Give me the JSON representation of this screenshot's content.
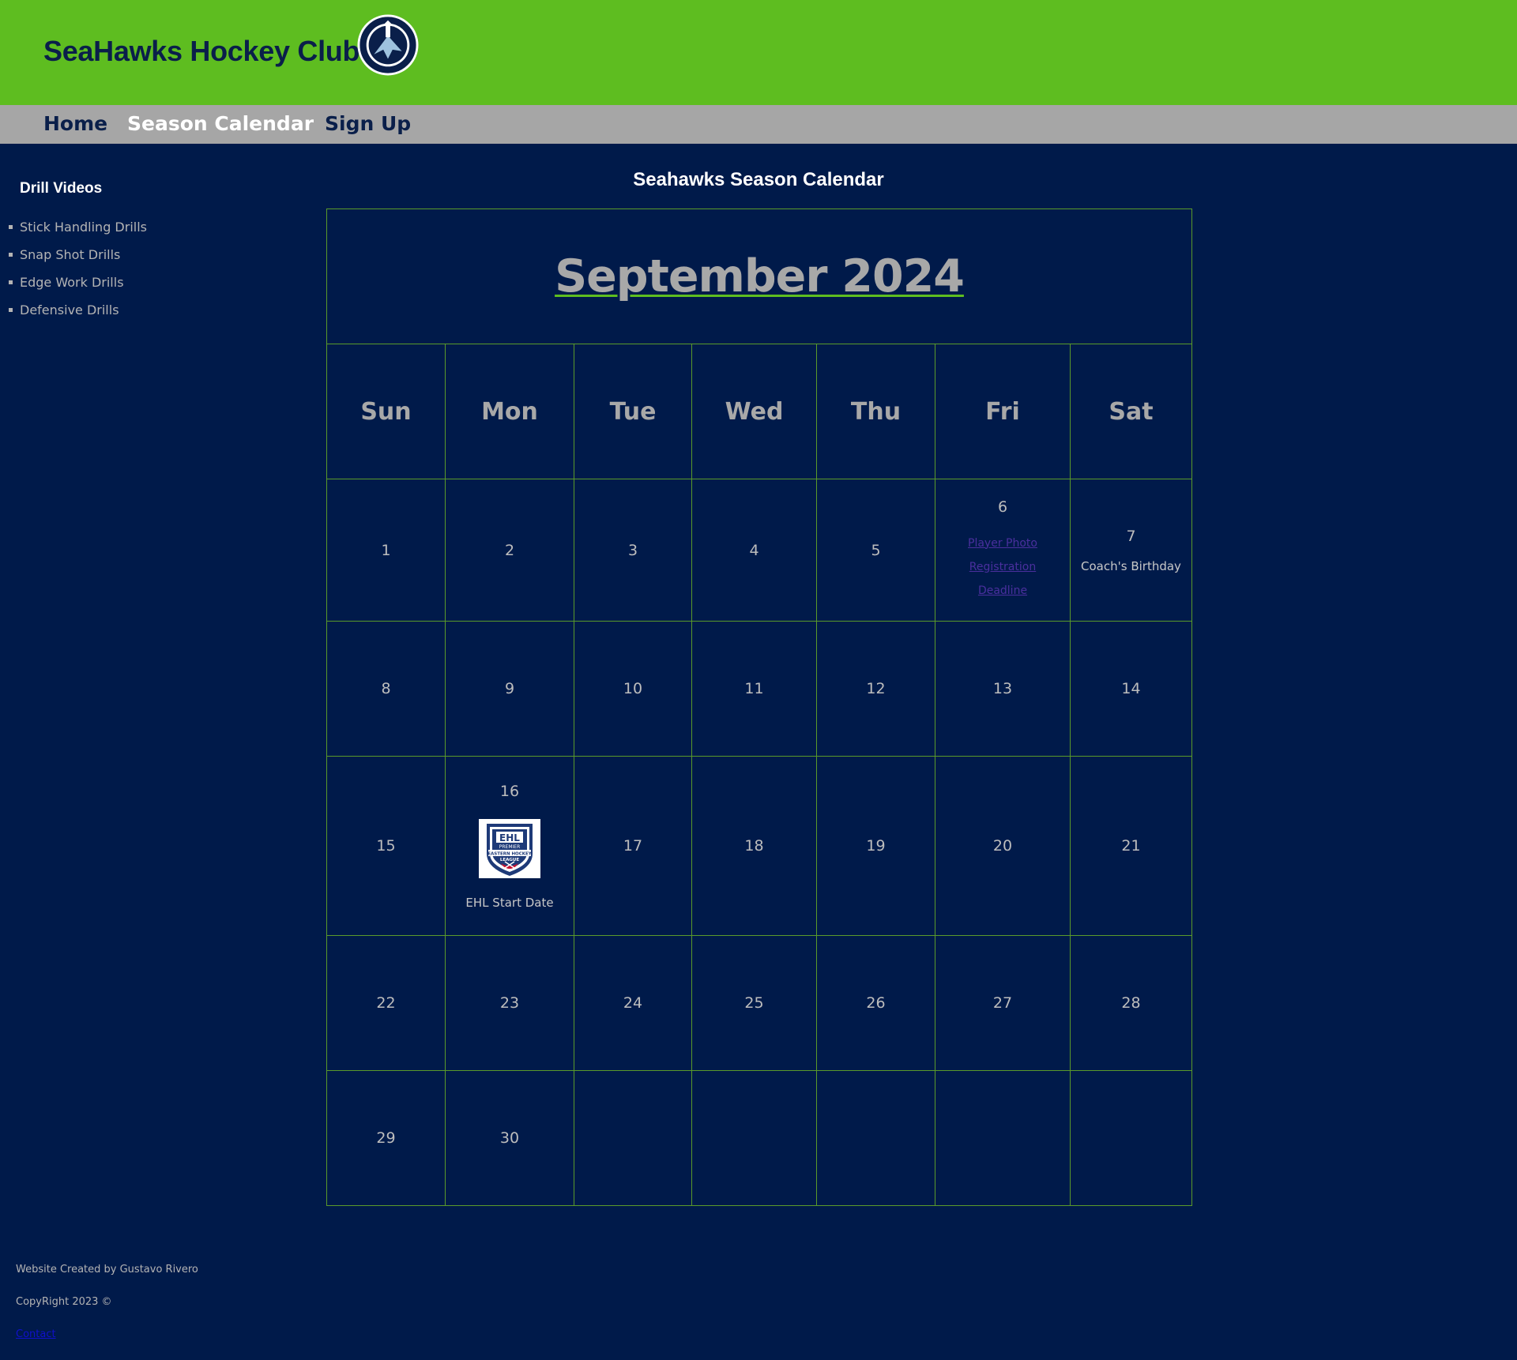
{
  "header": {
    "title": "SeaHawks Hockey Club",
    "logo_name": "seahawks-hockey-logo"
  },
  "nav": {
    "items": [
      {
        "label": "Home"
      },
      {
        "label": "Season Calendar",
        "active": true
      },
      {
        "label": "Sign Up"
      }
    ]
  },
  "sidebar": {
    "title": "Drill Videos",
    "items": [
      {
        "label": "Stick Handling Drills"
      },
      {
        "label": "Snap Shot Drills"
      },
      {
        "label": "Edge Work Drills"
      },
      {
        "label": "Defensive Drills"
      }
    ]
  },
  "calendar": {
    "heading": "Seahawks Season Calendar",
    "month": "September 2024",
    "days_of_week": [
      "Sun",
      "Mon",
      "Tue",
      "Wed",
      "Thu",
      "Fri",
      "Sat"
    ],
    "weeks": [
      [
        "1",
        "2",
        "3",
        "4",
        "5",
        "6",
        "7"
      ],
      [
        "8",
        "9",
        "10",
        "11",
        "12",
        "13",
        "14"
      ],
      [
        "15",
        "16",
        "17",
        "18",
        "19",
        "20",
        "21"
      ],
      [
        "22",
        "23",
        "24",
        "25",
        "26",
        "27",
        "28"
      ],
      [
        "29",
        "30",
        "",
        "",
        "",
        "",
        ""
      ]
    ],
    "events": {
      "sep6_link": "Player Photo Registration Deadline",
      "sep7_text": "Coach's Birthday",
      "sep16_image": "ehl-premier-logo",
      "sep16_text": "EHL Start Date"
    }
  },
  "footer": {
    "credit": "Website Created by Gustavo Rivero",
    "copyright": "CopyRight 2023 ©",
    "contact": "Contact"
  },
  "colors": {
    "header_bg": "#5ebd20",
    "nav_bg": "#a6a6a6",
    "page_bg": "#001a4a",
    "grid_line": "#5a9a2a",
    "brand_navy": "#0a1f4a"
  }
}
